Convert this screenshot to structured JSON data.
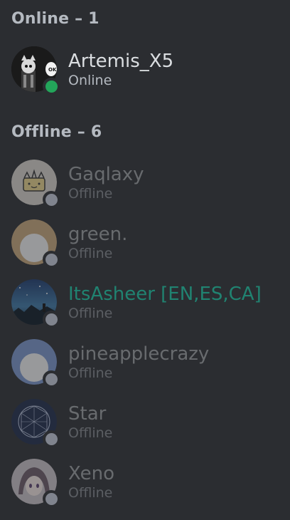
{
  "sections": {
    "online_header": "Online – 1",
    "offline_header": "Offline – 6"
  },
  "online_members": [
    {
      "name": "Artemis_X5",
      "status": "Online",
      "avatar_icon": "artemis-avatar-icon"
    }
  ],
  "offline_members": [
    {
      "name": "Gaqlaxy",
      "status": "Offline",
      "avatar_icon": "crown-blob-avatar-icon"
    },
    {
      "name": "green.",
      "status": "Offline",
      "avatar_icon": "default-avatar-icon"
    },
    {
      "name": "ItsAsheer [EN,ES,CA]",
      "status": "Offline",
      "avatar_icon": "night-sky-avatar-icon",
      "name_color": "#1abc9c"
    },
    {
      "name": "pineapplecrazy",
      "status": "Offline",
      "avatar_icon": "default-avatar-icon"
    },
    {
      "name": "Star",
      "status": "Offline",
      "avatar_icon": "geodesic-sphere-avatar-icon"
    },
    {
      "name": "Xeno",
      "status": "Offline",
      "avatar_icon": "anime-avatar-icon"
    }
  ],
  "colors": {
    "background": "#2b2d31",
    "online": "#23a55a",
    "offline": "#80848e",
    "teal_name": "#1abc9c"
  }
}
